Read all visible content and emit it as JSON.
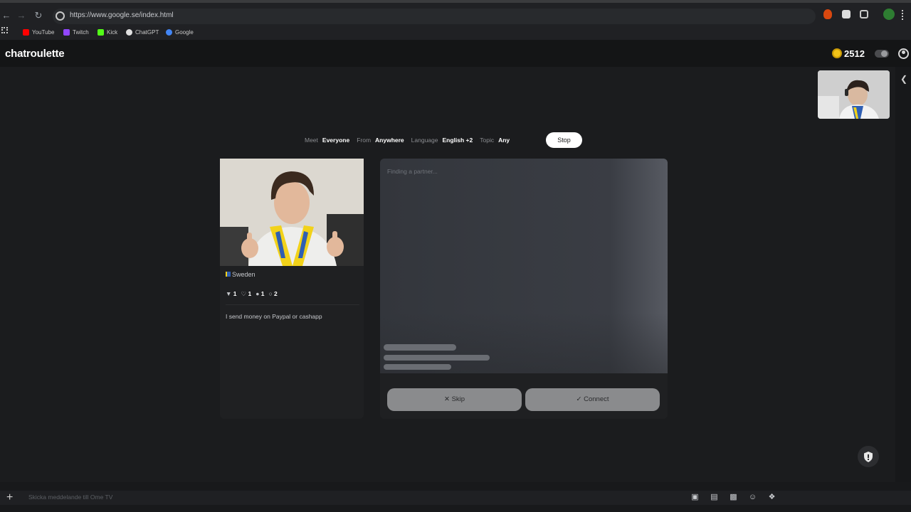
{
  "browser": {
    "url": "https://www.google.se/index.html",
    "bookmarks": [
      {
        "label": "YouTube",
        "color": "#ff0000"
      },
      {
        "label": "Twitch",
        "color": "#9146ff"
      },
      {
        "label": "Kick",
        "color": "#53fc18"
      },
      {
        "label": "ChatGPT",
        "color": "#e0e0e0"
      },
      {
        "label": "Google",
        "color": "#4285f4"
      }
    ]
  },
  "site": {
    "logo": "chatroulette",
    "coins": "2512"
  },
  "filters": {
    "meet_label": "Meet",
    "meet_value": "Everyone",
    "from_label": "From",
    "from_value": "Anywhere",
    "language_label": "Language",
    "language_value": "English +2",
    "topic_label": "Topic",
    "topic_value": "Any",
    "stop_label": "Stop"
  },
  "partner": {
    "country": "Sweden",
    "stats": [
      "1",
      "1",
      "1",
      "2"
    ],
    "bio": "I send money on Paypal or cashapp"
  },
  "chat": {
    "status": "Finding a partner...",
    "skip_label": "Skip",
    "connect_label": "Connect"
  },
  "bottom": {
    "message_placeholder": "Skicka meddelande till Ome TV"
  }
}
